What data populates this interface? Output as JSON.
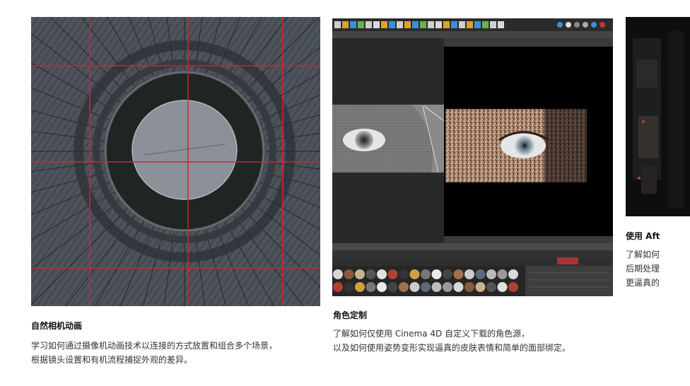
{
  "cards": [
    {
      "title": "自然相机动画",
      "desc_lines": [
        "学习如何通过摄像机动画技术以连接的方式放置和组合多个场景，",
        "根据镜头设置和有机流程捕捉外观的差异。"
      ]
    },
    {
      "title": "角色定制",
      "desc_lines": [
        "了解如何仅使用 Cinema 4D 自定义下载的角色源，",
        "以及如何使用姿势变形实现逼真的皮肤表情和简单的面部绑定。"
      ]
    },
    {
      "title": "使用 Aft",
      "desc_lines": [
        "了解如何",
        "后期处理",
        "更逼真的"
      ]
    }
  ],
  "colors": {
    "grid_red": "#d4242a",
    "wire_bg": "#505660",
    "c4d_bg": "#3b3b3b"
  }
}
